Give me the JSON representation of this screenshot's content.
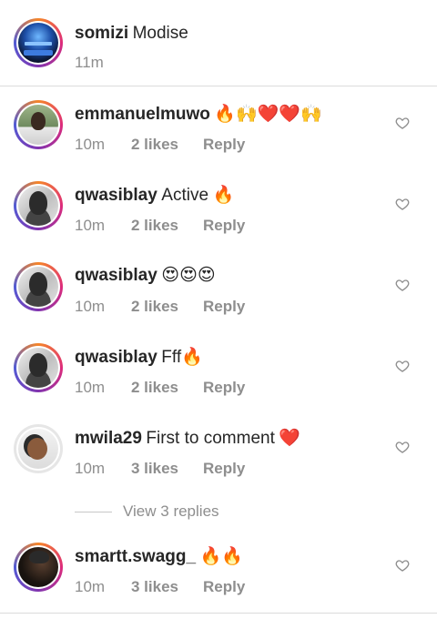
{
  "caption": {
    "username": "somizi",
    "text": "Modise",
    "time": "11m"
  },
  "comments": [
    {
      "username": "emmanuelmuwo",
      "text": "",
      "emoji": "🔥🙌❤️❤️🙌",
      "time": "10m",
      "likes": "2 likes",
      "reply": "Reply"
    },
    {
      "username": "qwasiblay",
      "text": "Active",
      "emoji": "🔥",
      "time": "10m",
      "likes": "2 likes",
      "reply": "Reply"
    },
    {
      "username": "qwasiblay",
      "text": "",
      "emoji": "😍😍😍",
      "time": "10m",
      "likes": "2 likes",
      "reply": "Reply"
    },
    {
      "username": "qwasiblay",
      "text": "Fff",
      "emoji": "🔥",
      "time": "10m",
      "likes": "2 likes",
      "reply": "Reply"
    },
    {
      "username": "mwila29",
      "text": "First to comment",
      "emoji": "❤️",
      "time": "10m",
      "likes": "3 likes",
      "reply": "Reply"
    },
    {
      "username": "smartt.swagg_",
      "text": "",
      "emoji": "🔥🔥",
      "time": "10m",
      "likes": "3 likes",
      "reply": "Reply"
    }
  ],
  "view_replies": "View 3 replies",
  "icons": {
    "like": "heart-outline-icon"
  },
  "colors": {
    "meta": "#8e8e8e",
    "text": "#262626",
    "divider": "#dbdbdb"
  }
}
